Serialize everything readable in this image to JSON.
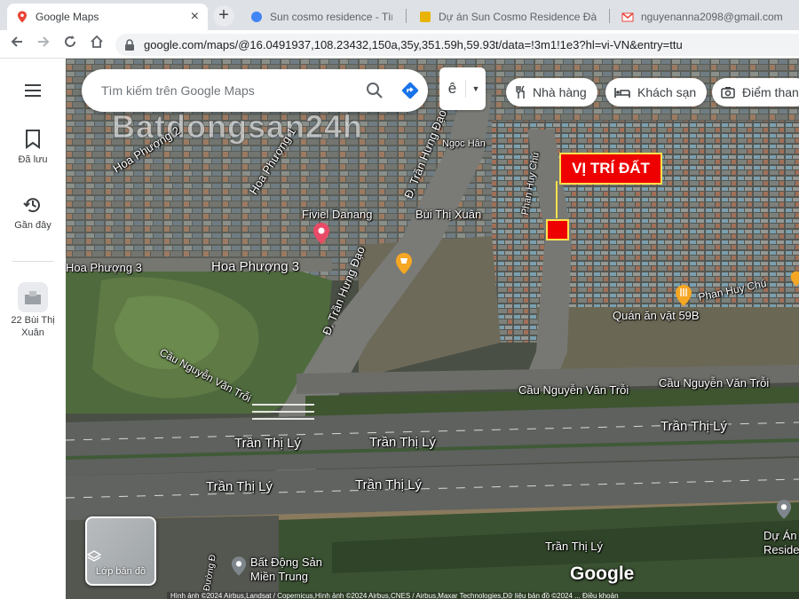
{
  "browser": {
    "tabs": [
      {
        "title": "Google Maps",
        "close": "×",
        "active": true
      },
      {
        "title": "Sun cosmo residence - Tìm trên Google",
        "active": false
      },
      {
        "title": "Dự án Sun Cosmo Residence Đà",
        "active": false
      },
      {
        "title": "nguyenanna2098@gmail.com",
        "active": false
      }
    ],
    "new_tab": "+",
    "url": "google.com/maps/@16.0491937,108.23432,150a,35y,351.59h,59.93t/data=!3m1!1e3?hl=vi-VN&entry=ttu"
  },
  "sidebar": {
    "saved_label": "Đã lưu",
    "recent_label": "Gần đây",
    "place_label_line1": "22 Bùi Thị",
    "place_label_line2": "Xuân"
  },
  "search": {
    "placeholder": "Tìm kiếm trên Google Maps"
  },
  "layer_toggle": {
    "glyph": "ê",
    "caret": "▼"
  },
  "chips": {
    "restaurants": "Nhà hàng",
    "hotels": "Khách sạn",
    "attractions": "Điểm than"
  },
  "map": {
    "labels": {
      "hoa_phuong_2": "Hoa Phượng 2",
      "hoa_phuong_1": "Hoa Phượng 1",
      "tran_hung_dao": "Đ. Trần Hưng Đạo",
      "ngoc_han": "Ngọc Hân",
      "phan_huy_chu_v": "Phan Huy Chú",
      "fiviel": "Fiviel Danang",
      "bui_thi_xuan": "Bùi Thị Xuân",
      "hoa_phuong_3a": "Hoa Phượng 3",
      "hoa_phuong_3b": "Hoa Phượng 3",
      "tran_hung_dao_2": "Đ. Trần Hưng Đạo",
      "phan_huy_chu": "Phan Huy Chú",
      "quan_an_vat": "Quán ăn vặt 59B",
      "cau_nvt_left": "Cầu Nguyễn Văn Trỗi",
      "cau_nvt_right1": "Cầu Nguyễn Văn Trỗi",
      "cau_nvt_right2": "Cầu Nguyễn Văn Trỗi",
      "ttl1": "Trần Thị Lý",
      "ttl2": "Trần Thị Lý",
      "ttl3": "Trần Thị Lý",
      "ttl4": "Trần Thị Lý",
      "ttl5": "Trần Thị Lý",
      "ttl6": "Trần Thị Lý",
      "bds1": "Bất Động Sản",
      "bds2": "Miền Trung",
      "du_an1": "Dự Án",
      "du_an2": "Reside",
      "thuong_d": "Đường Đ"
    },
    "marker_label": "VỊ TRÍ ĐẤT",
    "layers_button": "Lớp bản đồ",
    "google_logo": "Google",
    "credits": "Hình ảnh ©2024 Airbus,Landsat / Copernicus,Hình ảnh ©2024 Airbus,CNES / Airbus,Maxar Technologies,Dữ liệu bản đồ ©2024 ... Điều khoản",
    "watermark": "Batdongsan24h",
    "colors": {
      "marker_red": "#ee0000",
      "marker_border": "#ffe14d",
      "poi_orange": "#f5a623",
      "poi_red": "#e94b67"
    }
  }
}
